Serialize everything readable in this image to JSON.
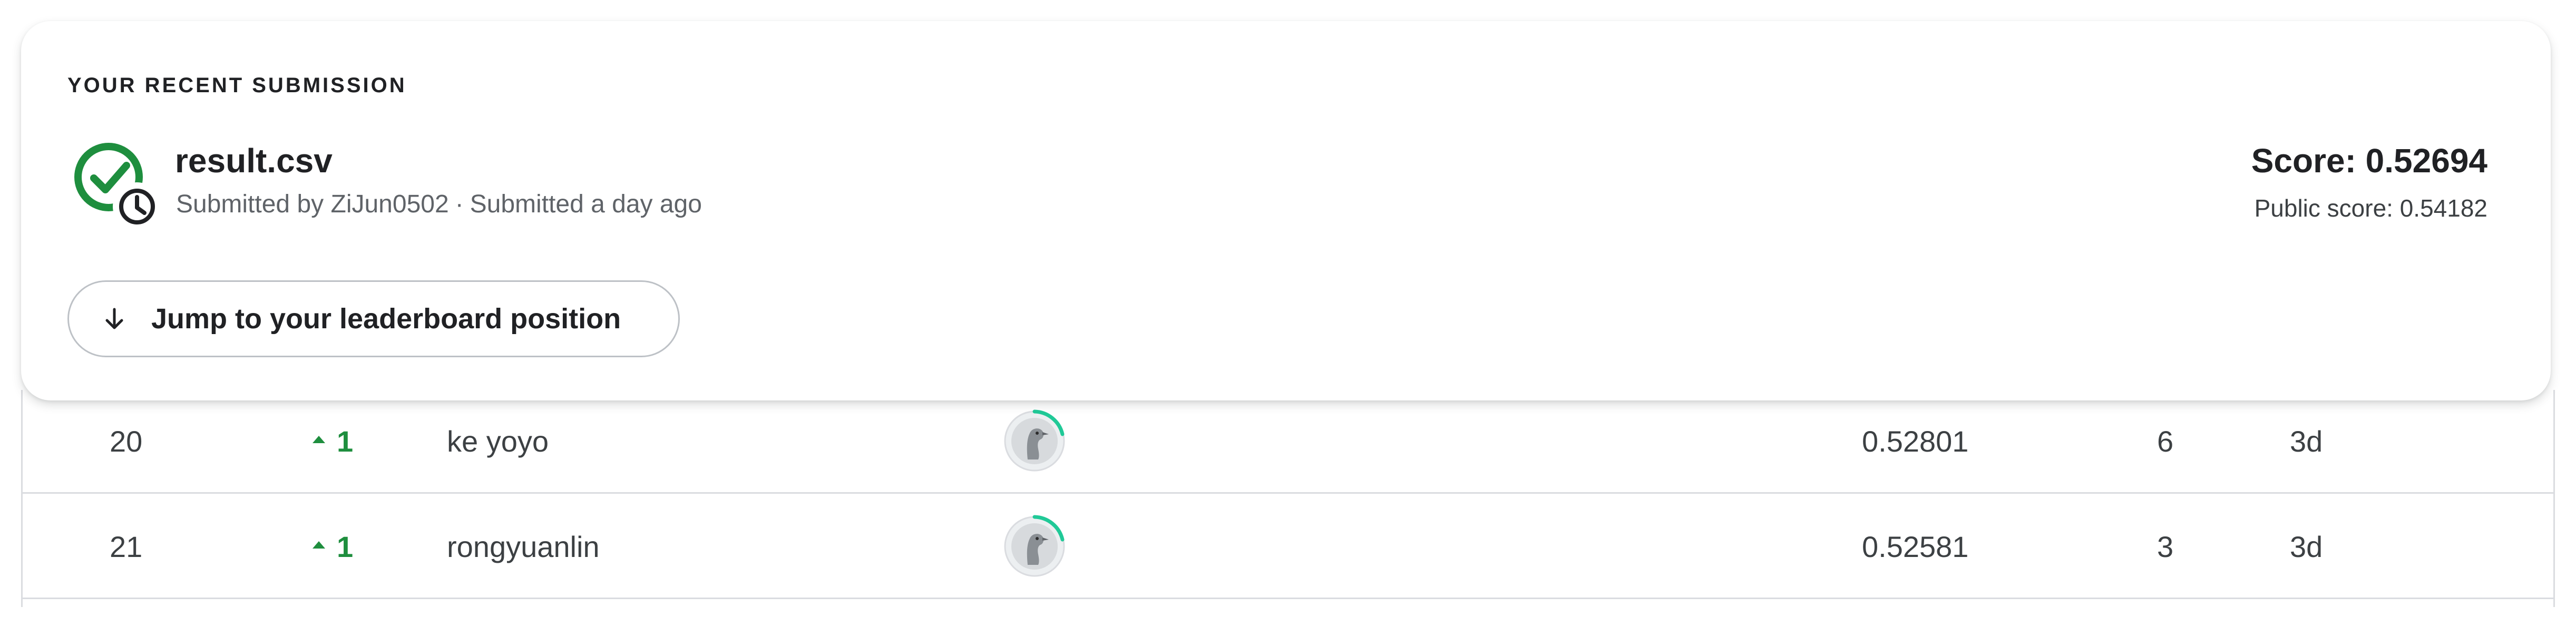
{
  "submission": {
    "heading": "YOUR RECENT SUBMISSION",
    "file_name": "result.csv",
    "submitted_by_prefix": "Submitted by",
    "submitter": "ZiJun0502",
    "separator": "·",
    "submitted_when": "Submitted a day ago",
    "score_label": "Score: 0.52694",
    "public_score_label": "Public score: 0.54182",
    "status_icon": "check-circle-with-clock-icon",
    "status_color": "#1e8e3e"
  },
  "jump_button": {
    "label": "Jump to your leaderboard position",
    "icon": "arrow-down-icon"
  },
  "leaderboard": {
    "rows": [
      {
        "rank": "20",
        "delta": "1",
        "delta_direction": "up",
        "team": "ke yoyo",
        "avatar_icon": "kaggle-default-avatar-icon",
        "score": "0.52801",
        "entries": "6",
        "last": "3d"
      },
      {
        "rank": "21",
        "delta": "1",
        "delta_direction": "up",
        "team": "rongyuanlin",
        "avatar_icon": "kaggle-default-avatar-icon",
        "score": "0.52581",
        "entries": "3",
        "last": "3d"
      }
    ],
    "delta_color": "#1e8e3e",
    "tier_ring_color": "#20beff"
  }
}
